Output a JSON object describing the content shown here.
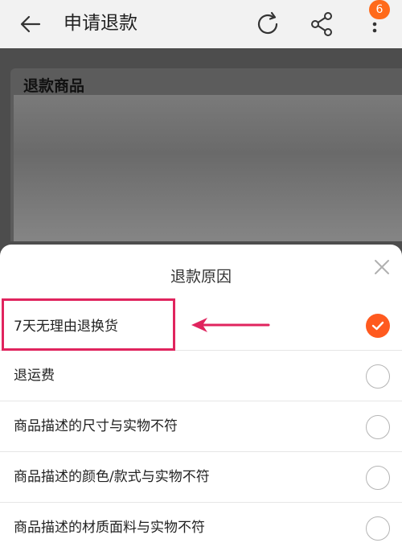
{
  "header": {
    "title": "申请退款",
    "back_icon": "arrow-left-icon",
    "refresh_icon": "refresh-icon",
    "share_icon": "share-icon",
    "more_icon": "more-vertical-icon",
    "badge_count": "6"
  },
  "background_page": {
    "section_title": "退款商品"
  },
  "sheet": {
    "title": "退款原因",
    "close_icon": "close-icon",
    "options": [
      {
        "label": "7天无理由退换货",
        "selected": true
      },
      {
        "label": "退运费",
        "selected": false
      },
      {
        "label": "商品描述的尺寸与实物不符",
        "selected": false
      },
      {
        "label": "商品描述的颜色/款式与实物不符",
        "selected": false
      },
      {
        "label": "商品描述的材质面料与实物不符",
        "selected": false
      }
    ]
  },
  "colors": {
    "accent": "#ff5a1f",
    "badge": "#ff6a1a",
    "annotation": "#e0245e"
  }
}
